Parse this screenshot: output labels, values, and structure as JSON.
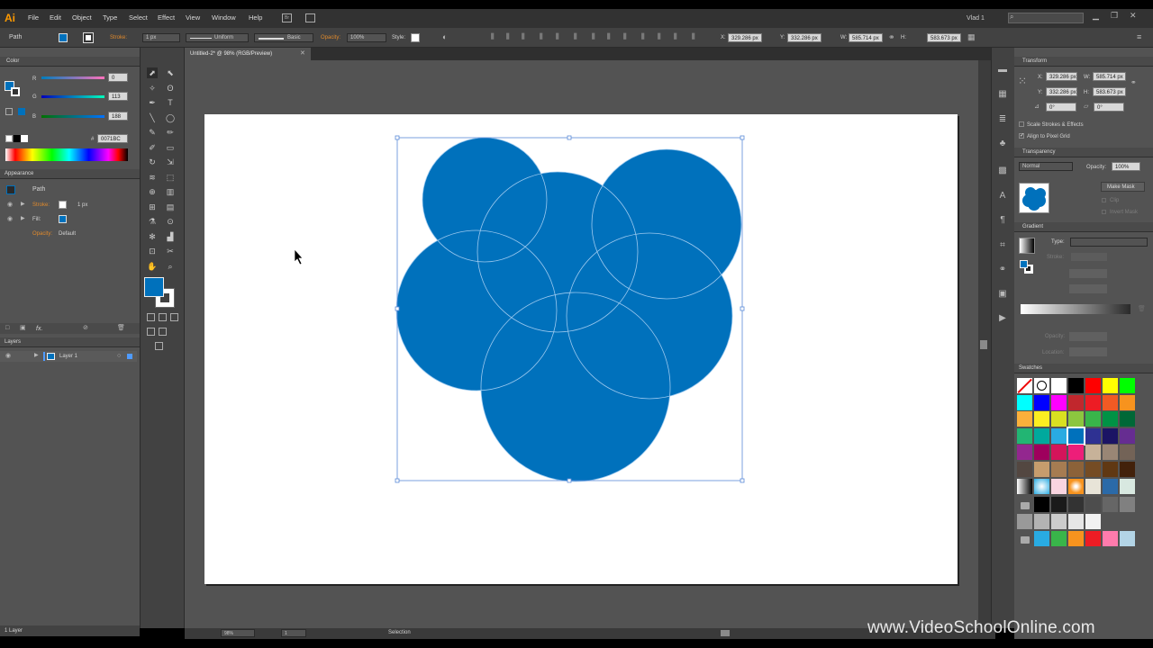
{
  "app": {
    "logo": "Ai",
    "user": "Vlad 1"
  },
  "menu": [
    "File",
    "Edit",
    "Object",
    "Type",
    "Select",
    "Effect",
    "View",
    "Window",
    "Help"
  ],
  "control_bar": {
    "selection_type": "Path",
    "stroke_label": "Stroke:",
    "stroke_weight": "1 px",
    "profile": "Uniform",
    "brush": "Basic",
    "opacity_label": "Opacity:",
    "opacity": "100%",
    "style_label": "Style:",
    "x_label": "X:",
    "x": "329.286 px",
    "y_label": "Y:",
    "y": "332.286 px",
    "w_label": "W:",
    "w": "585.714 px",
    "h_label": "H:",
    "h": "583.673 px"
  },
  "document": {
    "tab_title": "Untitled-2* @ 98% (RGB/Preview)"
  },
  "color_panel": {
    "title": "Color",
    "r_label": "R",
    "r": "0",
    "g_label": "G",
    "g": "113",
    "b_label": "B",
    "b": "188",
    "hex_label": "#",
    "hex": "0071BC"
  },
  "appearance_panel": {
    "title": "Appearance",
    "object": "Path",
    "stroke_label": "Stroke:",
    "stroke_value": "1 px",
    "fill_label": "Fill:",
    "opacity_label": "Opacity:",
    "opacity_value": "Default",
    "fx_label": "fx."
  },
  "layers_panel": {
    "title": "Layers",
    "layer_name": "Layer 1",
    "footer_count": "1 Layer"
  },
  "transform_panel": {
    "title": "Transform",
    "x_label": "X:",
    "x": "329.286 px",
    "y_label": "Y:",
    "y": "332.286 px",
    "w_label": "W:",
    "w": "585.714 px",
    "h_label": "H:",
    "h": "583.673 px",
    "angle": "0°",
    "shear": "0°",
    "scale_strokes": "Scale Strokes & Effects",
    "align_pixel_grid": "Align to Pixel Grid"
  },
  "transparency_panel": {
    "title": "Transparency",
    "blend_mode": "Normal",
    "opacity_label": "Opacity:",
    "opacity": "100%",
    "make_mask": "Make Mask",
    "clip": "Clip",
    "invert_mask": "Invert Mask"
  },
  "gradient_panel": {
    "title": "Gradient",
    "type_label": "Type:",
    "stroke_label": "Stroke:",
    "opacity_label": "Opacity:",
    "location_label": "Location:"
  },
  "swatches_panel": {
    "title": "Swatches",
    "rows": [
      [
        "none",
        "reg",
        "#ffffff",
        "#000000",
        "#ff0000",
        "#ffff00",
        "#00ff00"
      ],
      [
        "#00ffff",
        "#0000ff",
        "#ff00ff",
        "#c1272d",
        "#ed1c24",
        "#f15a24",
        "#f7931e"
      ],
      [
        "#fbb03b",
        "#fcee21",
        "#d9e021",
        "#8cc63f",
        "#39b54a",
        "#009245",
        "#006837"
      ],
      [
        "#22b573",
        "#00a99d",
        "#29abe2",
        "#0071bc",
        "#2e3192",
        "#1b1464",
        "#662d91"
      ],
      [
        "#93278f",
        "#9e005d",
        "#d4145a",
        "#ed1e79",
        "#c7b299",
        "#998675",
        "#736357"
      ],
      [
        "#534741",
        "#c69c6d",
        "#a67c52",
        "#8c6239",
        "#754c24",
        "#603813",
        "#42210b"
      ]
    ],
    "gray_row": [
      "#000000",
      "#1a1a1a",
      "#333333",
      "#4d4d4d",
      "#666666",
      "#808080"
    ],
    "gray_row2": [
      "#999999",
      "#b3b3b3",
      "#cccccc",
      "#e6e6e6",
      "#f2f2f2"
    ],
    "last_row": [
      "#29abe2",
      "#39b54a",
      "#f7931e",
      "#ed1c24",
      "#ff7bac",
      "#b3d4e6"
    ]
  },
  "status_bar": {
    "zoom": "98%",
    "page": "1",
    "tool": "Selection"
  },
  "watermark": "www.VideoSchoolOnline.com",
  "colors": {
    "fill": "#0071bc",
    "ui_bg": "#535353",
    "artboard": "#ffffff"
  }
}
